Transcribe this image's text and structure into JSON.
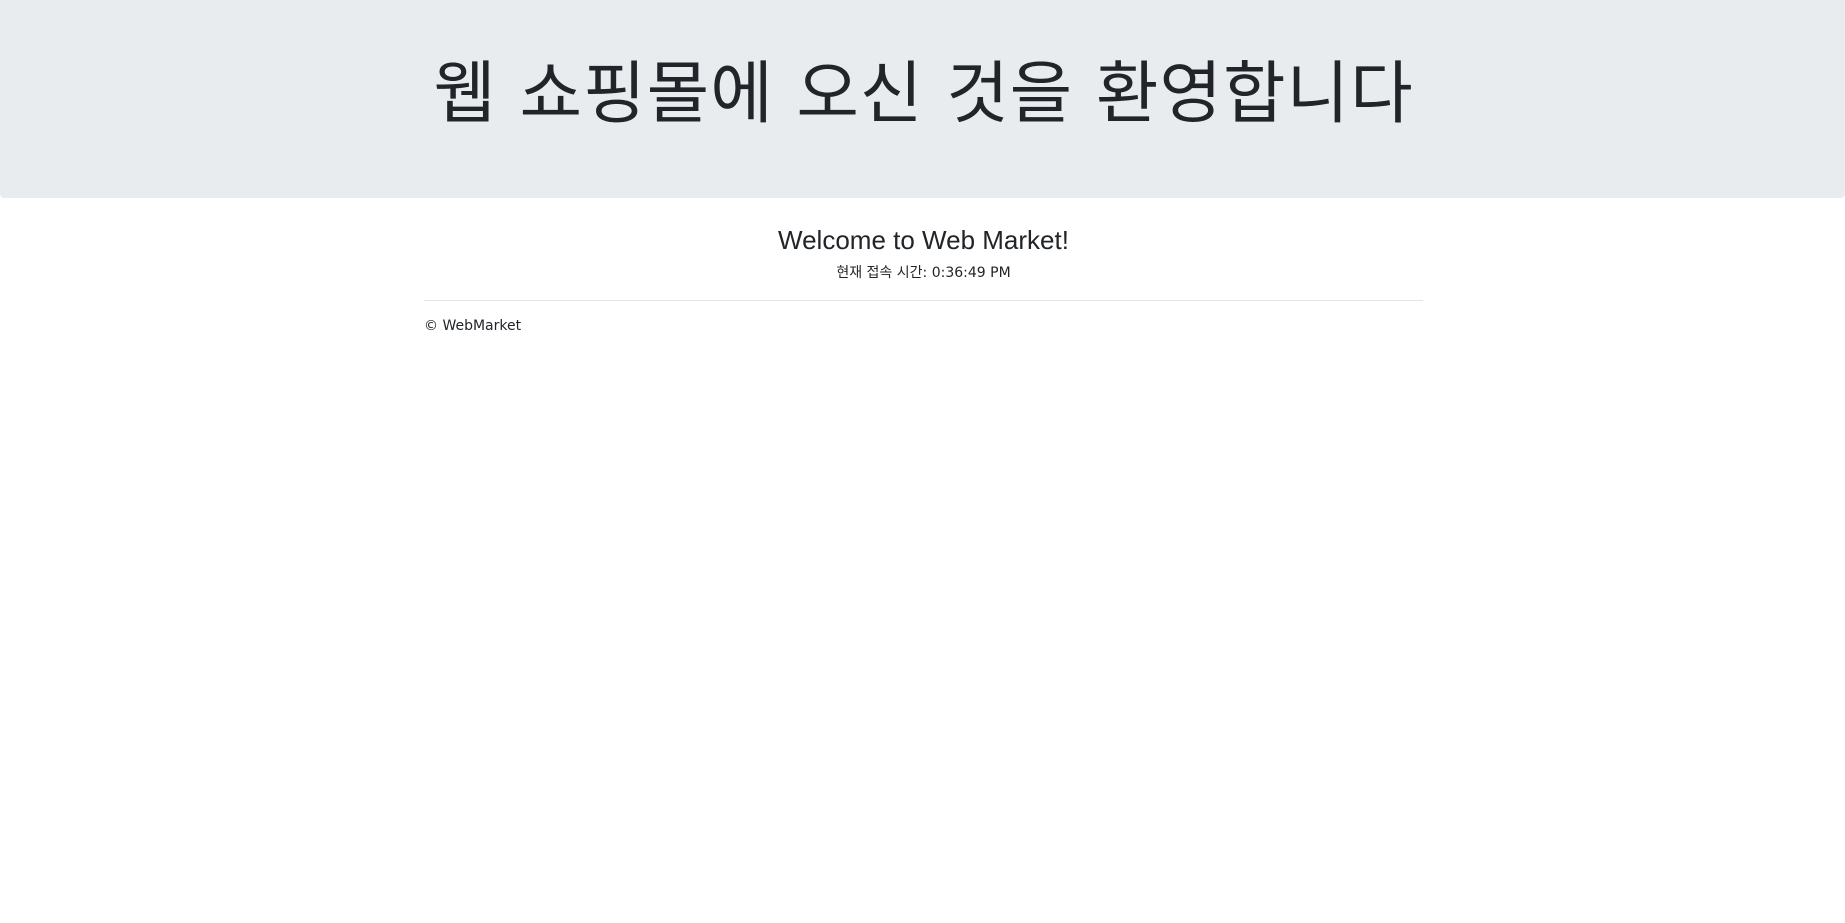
{
  "header": {
    "title": "웹 쇼핑몰에 오신 것을 환영합니다"
  },
  "main": {
    "welcome": "Welcome to Web Market!",
    "access_time_label": "현재 접속 시간: ",
    "access_time_value": "0:36:49 PM"
  },
  "footer": {
    "copyright": "© WebMarket"
  },
  "colors": {
    "header_background": "#e9ecef",
    "text": "#212529",
    "divider": "#e2e4e7",
    "page_background": "#ffffff"
  }
}
